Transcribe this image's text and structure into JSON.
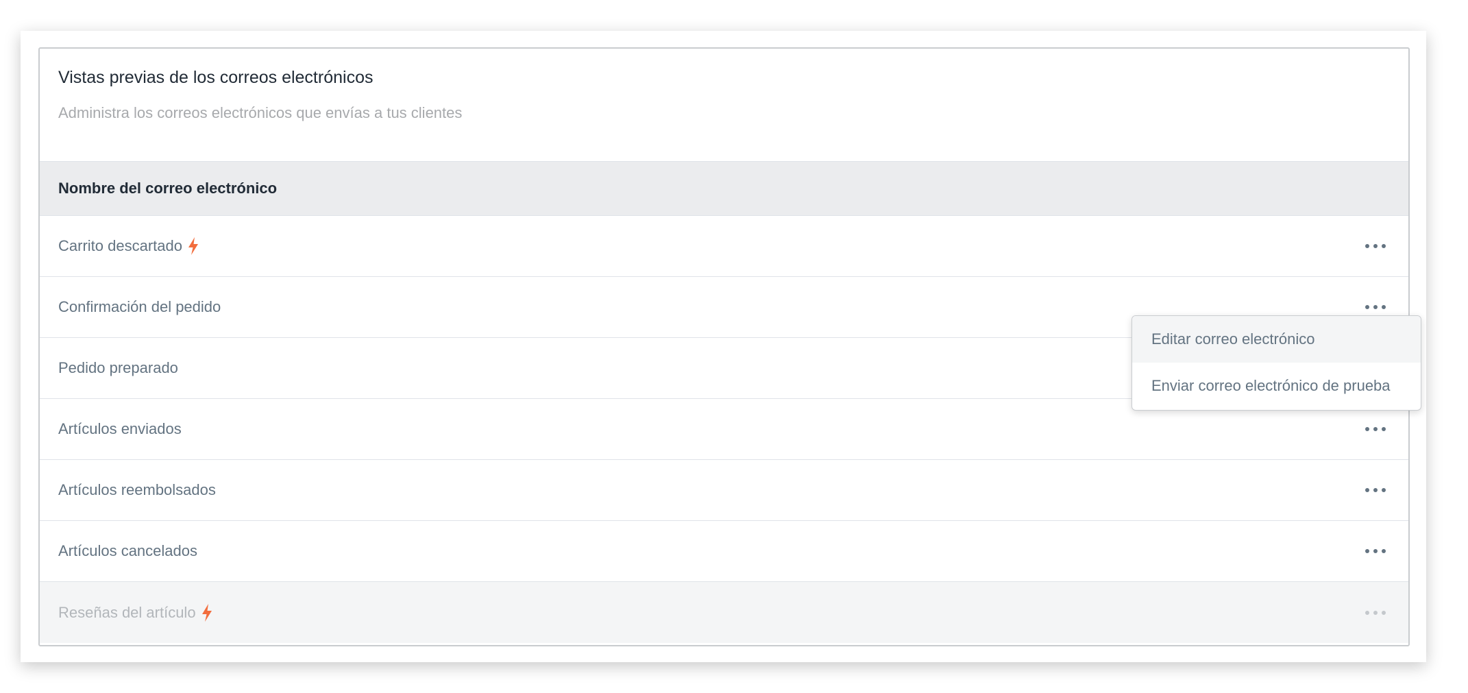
{
  "card": {
    "title": "Vistas previas de los correos electrónicos",
    "subtitle": "Administra los correos electrónicos que envías a tus clientes"
  },
  "table": {
    "column_header": "Nombre del correo electrónico",
    "rows": [
      {
        "label": "Carrito descartado",
        "icon": "bolt-icon",
        "disabled": false
      },
      {
        "label": "Confirmación del pedido",
        "icon": null,
        "disabled": false
      },
      {
        "label": "Pedido preparado",
        "icon": null,
        "disabled": false
      },
      {
        "label": "Artículos enviados",
        "icon": null,
        "disabled": false
      },
      {
        "label": "Artículos reembolsados",
        "icon": null,
        "disabled": false
      },
      {
        "label": "Artículos cancelados",
        "icon": null,
        "disabled": false
      },
      {
        "label": "Reseñas del artículo",
        "icon": "bolt-icon",
        "disabled": true
      }
    ]
  },
  "popover": {
    "items": [
      {
        "label": "Editar correo electrónico"
      },
      {
        "label": "Enviar correo electrónico de prueba"
      }
    ]
  },
  "colors": {
    "accent_bolt": "#f26d3d",
    "text_primary": "#212b36",
    "text_secondary": "#637381",
    "text_muted": "#a7a9ac",
    "header_bg": "#ebecee"
  }
}
